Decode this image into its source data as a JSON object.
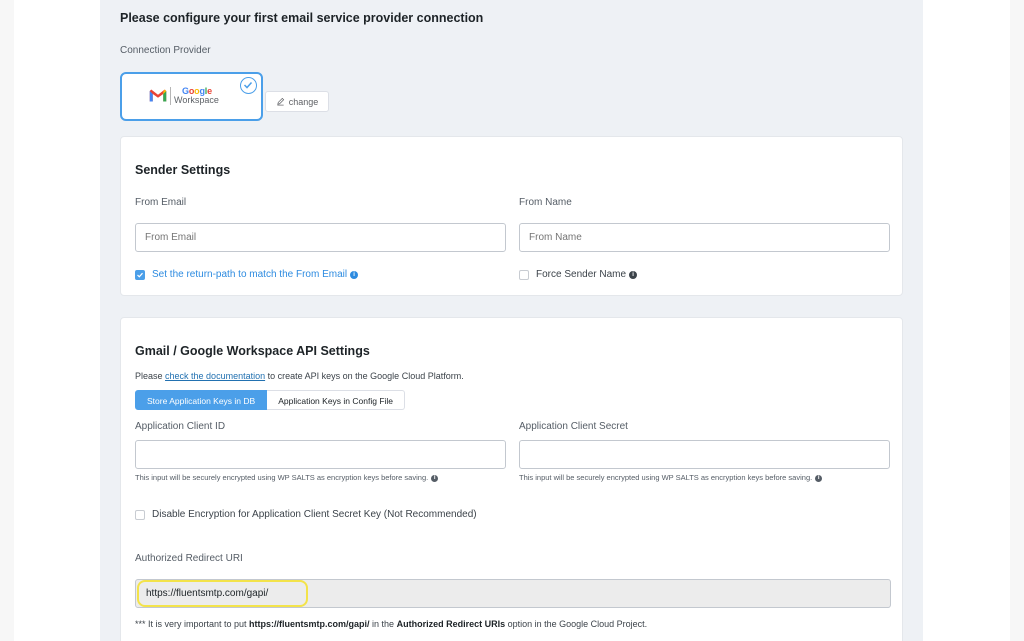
{
  "page": {
    "heading": "Please configure your first email service provider connection",
    "provider_label": "Connection Provider",
    "provider": {
      "logo_google": [
        "G",
        "o",
        "o",
        "g",
        "l",
        "e"
      ],
      "logo_workspace": "Workspace",
      "change_label": "change"
    }
  },
  "sender": {
    "title": "Sender Settings",
    "from_email_label": "From Email",
    "from_email_placeholder": "From Email",
    "from_name_label": "From Name",
    "from_name_placeholder": "From Name",
    "return_path_label": "Set the return-path to match the From Email",
    "return_path_checked": true,
    "force_sender_label": "Force Sender Name",
    "force_sender_checked": false
  },
  "api": {
    "title": "Gmail / Google Workspace API Settings",
    "doc_prefix": "Please ",
    "doc_link": "check the documentation",
    "doc_suffix": " to create API keys on the Google Cloud Platform.",
    "tabs": [
      "Store Application Keys in DB",
      "Application Keys in Config File"
    ],
    "client_id_label": "Application Client ID",
    "client_id_value": "",
    "client_secret_label": "Application Client Secret",
    "client_secret_value": "",
    "encryption_help": "This input will be securely encrypted using WP SALTS as encryption keys before saving.",
    "disable_encryption_label": "Disable Encryption for Application Client Secret Key (Not Recommended)",
    "redirect_label": "Authorized Redirect URI",
    "redirect_value": "https://fluentsmtp.com/gapi/",
    "note_prefix": "*** It is very important to put ",
    "note_url": "https://fluentsmtp.com/gapi/",
    "note_middle": " in the ",
    "note_bold": "Authorized Redirect URIs",
    "note_suffix": " option in the Google Cloud Project."
  },
  "colors": {
    "accent": "#4b9fe9",
    "highlight": "#f3e34a"
  }
}
